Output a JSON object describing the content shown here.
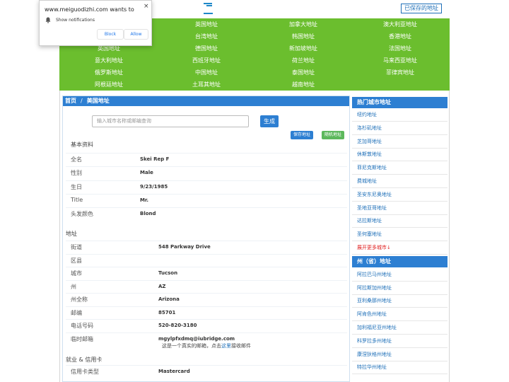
{
  "popup": {
    "title": "www.meiguodizhi.com wants to",
    "close": "×",
    "message": "Show notifications",
    "block_label": "Block",
    "allow_label": "Allow"
  },
  "header": {
    "saved_link": "已保存的地址"
  },
  "nav": {
    "items": [
      "英国地址",
      "加拿大地址",
      "澳大利亚地址",
      "台湾地址",
      "韩国地址",
      "香港地址",
      "英国地址",
      "德国地址",
      "新加坡地址",
      "法国地址",
      "意大利地址",
      "西班牙地址",
      "荷兰地址",
      "马来西亚地址",
      "俄罗斯地址",
      "中国地址",
      "泰国地址",
      "菲律宾地址",
      "阿根廷地址",
      "土耳其地址",
      "越南地址"
    ]
  },
  "breadcrumb": {
    "home": "首页",
    "separator": "/",
    "current": "美国地址"
  },
  "search": {
    "placeholder": "输入城市名称或邮编查询",
    "generate_label": "生成",
    "save_label": "保存地址",
    "random_label": "随机地址"
  },
  "basic": {
    "title": "基本资料",
    "rows": [
      {
        "label": "全名",
        "value": "Skei Rep F"
      },
      {
        "label": "性别",
        "value": "Male"
      },
      {
        "label": "生日",
        "value": "9/23/1985"
      },
      {
        "label": "Title",
        "value": "Mr."
      },
      {
        "label": "头发颜色",
        "value": "Blond"
      }
    ]
  },
  "address": {
    "title": "地址",
    "rows": [
      {
        "label": "街道",
        "value": "548  Parkway Drive"
      },
      {
        "label": "区县",
        "value": ""
      },
      {
        "label": "城市",
        "value": "Tucson"
      },
      {
        "label": "州",
        "value": "AZ"
      },
      {
        "label": "州全称",
        "value": "Arizona"
      },
      {
        "label": "邮编",
        "value": "85701"
      },
      {
        "label": "电话号码",
        "value": "520-820-3180"
      },
      {
        "label": "临时邮箱",
        "value": "mgylpfxdmq@iubridge.com"
      }
    ],
    "note_prefix": "这是一个真实的邮箱，点击",
    "note_link": "这里",
    "note_suffix": "接收邮件"
  },
  "card": {
    "title": "就业 & 信用卡",
    "rows": [
      {
        "label": "信用卡类型",
        "value": "Mastercard"
      }
    ]
  },
  "sidebar": {
    "hot_title": "热门城市地址",
    "hot_cities": [
      "纽约地址",
      "洛杉矶地址",
      "芝加哥地址",
      "休斯敦地址",
      "菲尼克斯地址",
      "费城地址",
      "圣安东尼奥地址",
      "圣地亚哥地址",
      "达拉斯地址",
      "圣何塞地址"
    ],
    "more_label": "展开更多城市↓",
    "state_title": "州（省）地址",
    "states": [
      "阿拉巴马州地址",
      "阿拉斯加州地址",
      "亚利桑那州地址",
      "阿肯色州地址",
      "加利福尼亚州地址",
      "科罗拉多州地址",
      "康涅狄格州地址",
      "特拉华州地址"
    ]
  }
}
